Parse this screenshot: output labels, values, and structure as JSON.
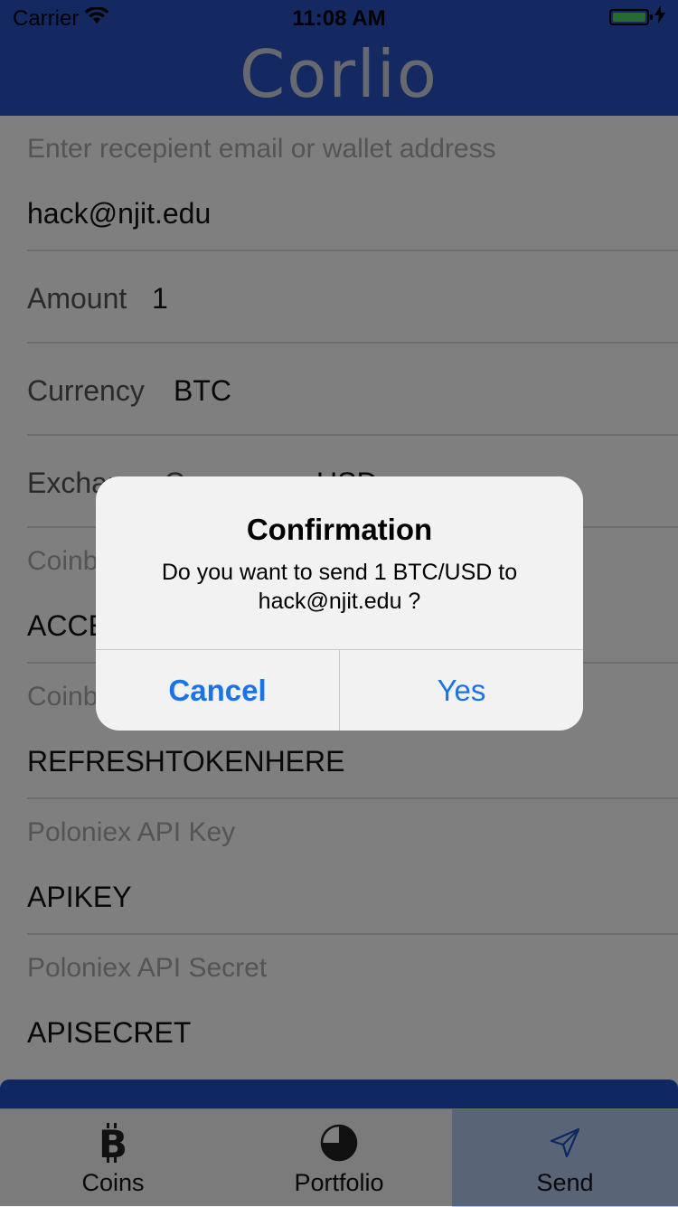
{
  "status": {
    "carrier": "Carrier",
    "time": "11:08 AM"
  },
  "app": {
    "title": "Corlio"
  },
  "form": {
    "recipient_label": "Enter recepient email or wallet address",
    "recipient_value": "hack@njit.edu",
    "amount_label": "Amount",
    "amount_value": "1",
    "currency_label": "Currency",
    "currency_value": "BTC",
    "exchange_label": "Exchange Currency",
    "exchange_value": "USD",
    "coinbase_access_label": "Coinbase Access Token",
    "coinbase_access_value": "ACCESSTOKENHERE",
    "coinbase_refresh_label": "Coinbase Refresh Token",
    "coinbase_refresh_value": "REFRESHTOKENHERE",
    "poloniex_key_label": "Poloniex API Key",
    "poloniex_key_value": "APIKEY",
    "poloniex_secret_label": "Poloniex API Secret",
    "poloniex_secret_value": "APISECRET"
  },
  "tabs": [
    {
      "label": "Coins",
      "icon": "bitcoin-icon"
    },
    {
      "label": "Portfolio",
      "icon": "pie-chart-icon"
    },
    {
      "label": "Send",
      "icon": "paper-plane-icon"
    }
  ],
  "dialog": {
    "title": "Confirmation",
    "message_line1": "Do you want to send 1 BTC/USD to",
    "message_line2": "hack@njit.edu ?",
    "cancel_label": "Cancel",
    "confirm_label": "Yes"
  },
  "colors": {
    "header": "#2853c4",
    "button_blue": "#1a73e8",
    "battery": "#4cd964",
    "active_tab": "#b5c8ef"
  }
}
